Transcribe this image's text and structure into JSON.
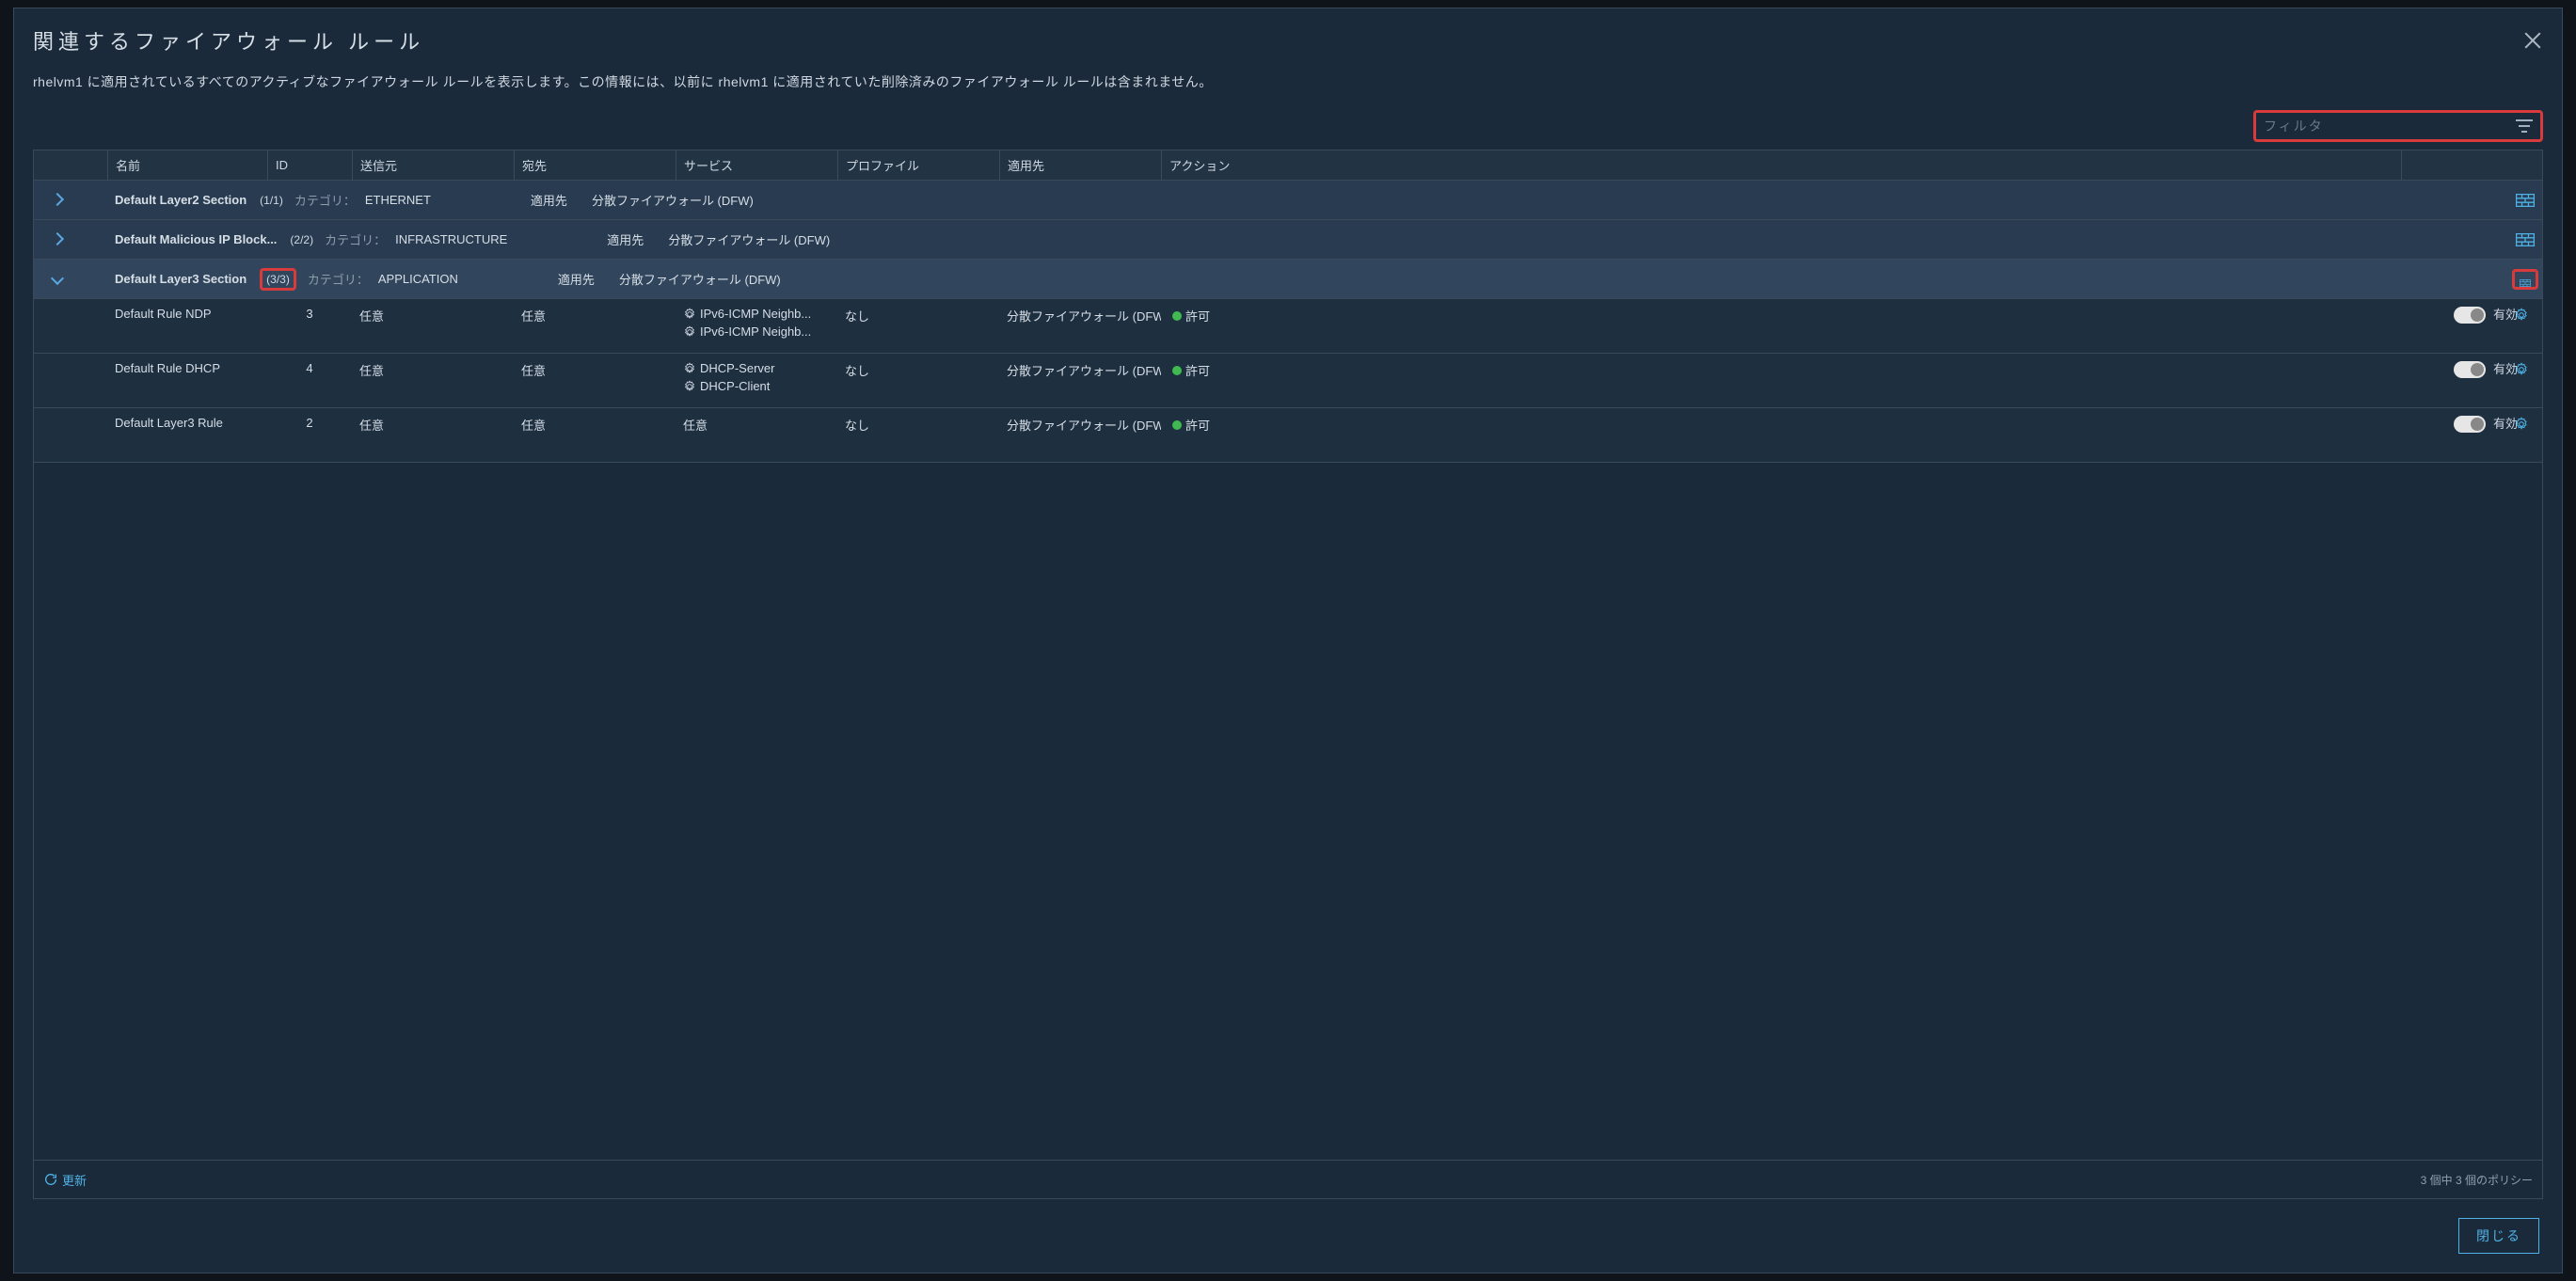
{
  "title": "関連するファイアウォール ルール",
  "description": "rhelvm1 に適用されているすべてのアクティブなファイアウォール ルールを表示します。この情報には、以前に rhelvm1 に適用されていた削除済みのファイアウォール ルールは含まれません。",
  "filter_placeholder": "フィルタ",
  "columns": {
    "name": "名前",
    "id": "ID",
    "src": "送信元",
    "dst": "宛先",
    "svc": "サービス",
    "prof": "プロファイル",
    "appl": "適用先",
    "act": "アクション"
  },
  "labels": {
    "category": "カテゴリ：",
    "applied_to": "適用先"
  },
  "sections": [
    {
      "name": "Default Layer2 Section",
      "count": "(1/1)",
      "count_highlight": false,
      "category": "ETHERNET",
      "applied_to": "分散ファイアウォール (DFW)",
      "expanded": false,
      "icon_highlight": false,
      "rules": []
    },
    {
      "name": "Default Malicious IP Block...",
      "count": "(2/2)",
      "count_highlight": false,
      "category": "INFRASTRUCTURE",
      "applied_to": "分散ファイアウォール (DFW)",
      "expanded": false,
      "icon_highlight": false,
      "rules": []
    },
    {
      "name": "Default Layer3 Section",
      "count": "(3/3)",
      "count_highlight": true,
      "category": "APPLICATION",
      "applied_to": "分散ファイアウォール (DFW)",
      "expanded": true,
      "icon_highlight": true,
      "rules": [
        {
          "name": "Default Rule NDP",
          "id": "3",
          "src": "任意",
          "dst": "任意",
          "services": [
            "IPv6-ICMP Neighb...",
            "IPv6-ICMP Neighb..."
          ],
          "profile": "なし",
          "applied": "分散ファイアウォール (DFW)",
          "action": "許可",
          "toggle_label": "有効"
        },
        {
          "name": "Default Rule DHCP",
          "id": "4",
          "src": "任意",
          "dst": "任意",
          "services": [
            "DHCP-Server",
            "DHCP-Client"
          ],
          "profile": "なし",
          "applied": "分散ファイアウォール (DFW)",
          "action": "許可",
          "toggle_label": "有効"
        },
        {
          "name": "Default Layer3 Rule",
          "id": "2",
          "src": "任意",
          "dst": "任意",
          "services": [
            "任意"
          ],
          "profile": "なし",
          "applied": "分散ファイアウォール (DFW)",
          "action": "許可",
          "toggle_label": "有効"
        }
      ]
    }
  ],
  "footer": {
    "refresh": "更新",
    "summary": "3 個中 3 個のポリシー"
  },
  "close_button": "閉じる"
}
